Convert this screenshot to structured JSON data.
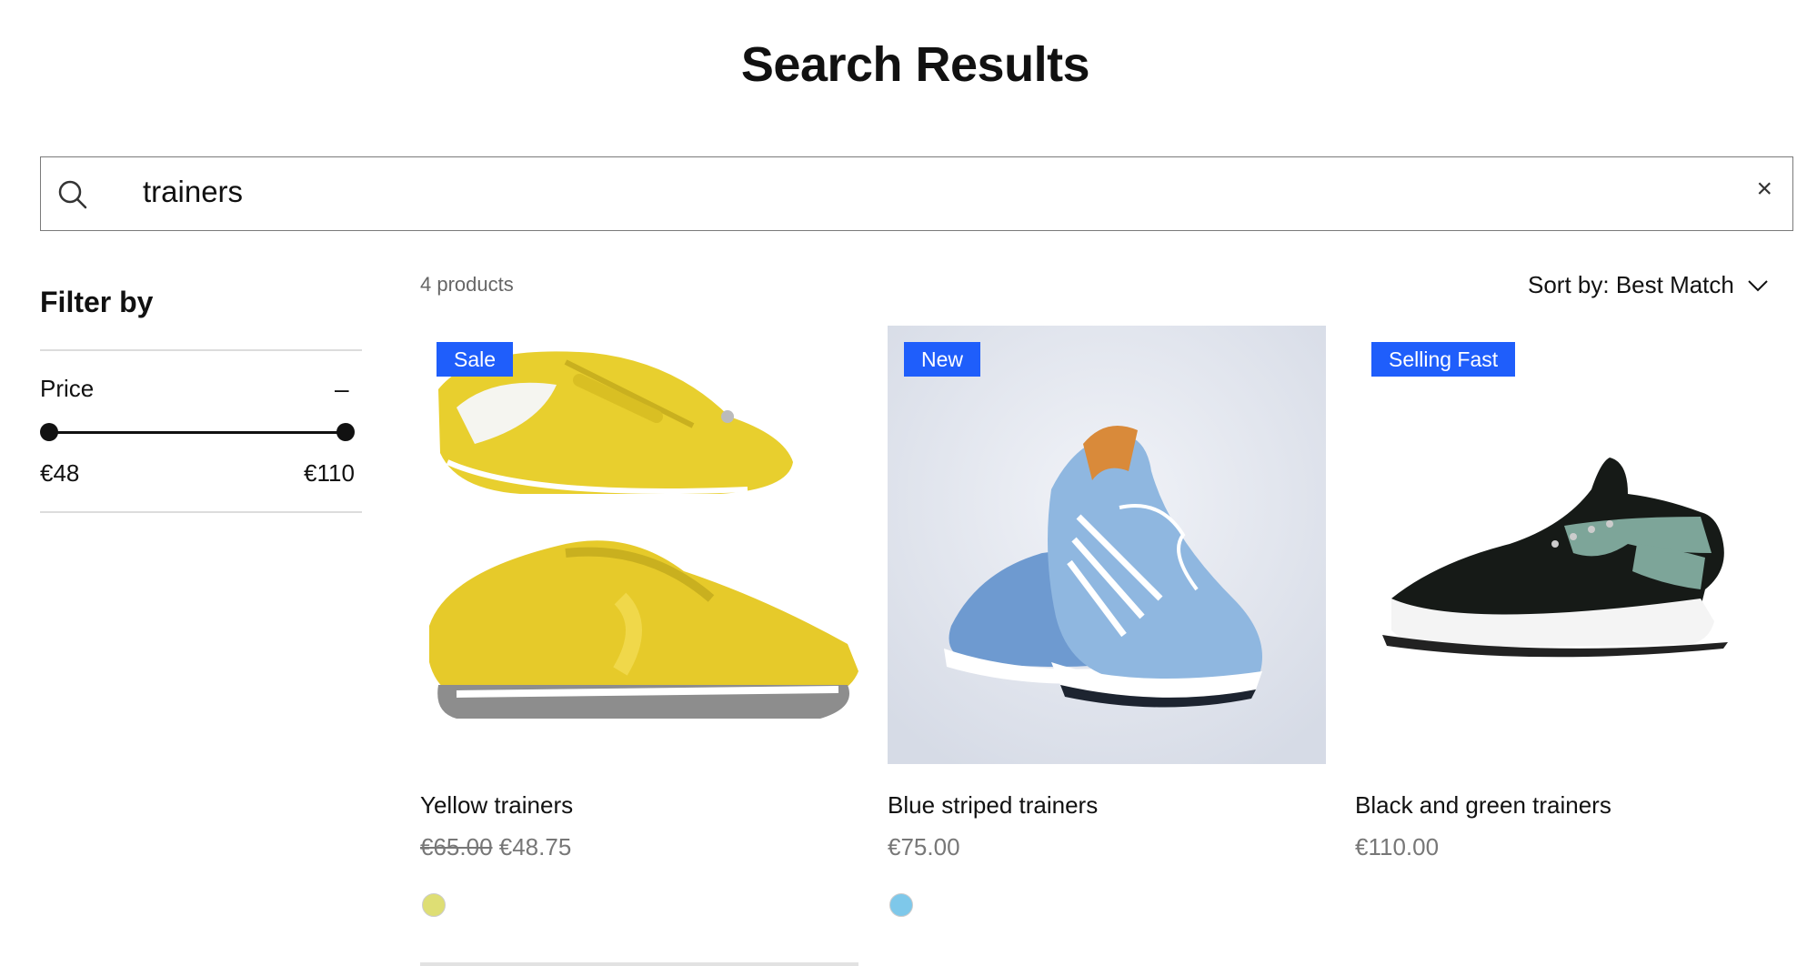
{
  "page": {
    "title": "Search Results"
  },
  "search": {
    "value": "trainers",
    "clear_label": "×"
  },
  "filter": {
    "title": "Filter by",
    "price": {
      "label": "Price",
      "collapse_label": "–",
      "min_label": "€48",
      "max_label": "€110",
      "min": 48,
      "max": 110
    }
  },
  "results": {
    "count_label": "4 products",
    "sort_label": "Sort by: Best Match"
  },
  "products": [
    {
      "badge": "Sale",
      "name": "Yellow trainers",
      "old_price": "€65.00",
      "price": "€48.75",
      "swatch_color": "#dede74"
    },
    {
      "badge": "New",
      "name": "Blue striped trainers",
      "price": "€75.00",
      "swatch_color": "#7ec8ea"
    },
    {
      "badge": "Selling Fast",
      "name": "Black and green trainers",
      "price": "€110.00"
    }
  ],
  "colors": {
    "accent": "#1f5efb",
    "text": "#111111",
    "muted": "#777777"
  }
}
